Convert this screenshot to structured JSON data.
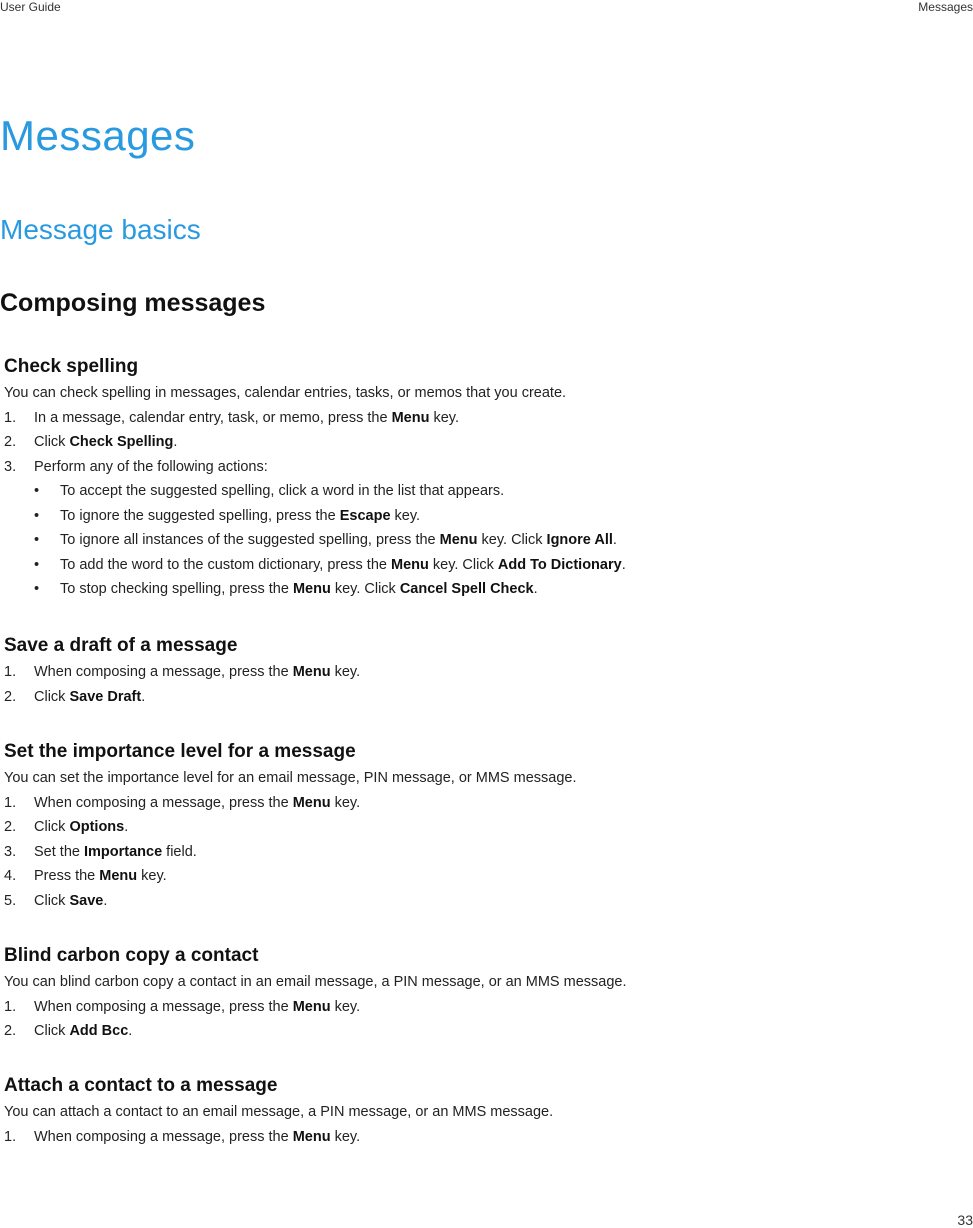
{
  "header": {
    "left": "User Guide",
    "right": "Messages"
  },
  "page_number": "33",
  "titles": {
    "chapter": "Messages",
    "section": "Message basics",
    "subsection": "Composing messages"
  },
  "topics": [
    {
      "title": "Check spelling",
      "intro": "You can check spelling in messages, calendar entries, tasks, or memos that you create.",
      "steps": [
        {
          "n": "1.",
          "pre": "In a message, calendar entry, task, or memo, press the ",
          "bold": "Menu",
          "post": " key."
        },
        {
          "n": "2.",
          "pre": "Click ",
          "bold": "Check Spelling",
          "post": "."
        },
        {
          "n": "3.",
          "pre": "Perform any of the following actions:",
          "bold": "",
          "post": ""
        }
      ],
      "bullets": [
        {
          "pre": "To accept the suggested spelling, click a word in the list that appears.",
          "b1": "",
          "mid": "",
          "b2": "",
          "post": ""
        },
        {
          "pre": "To ignore the suggested spelling, press the ",
          "b1": "Escape",
          "mid": " key.",
          "b2": "",
          "post": ""
        },
        {
          "pre": "To ignore all instances of the suggested spelling, press the ",
          "b1": "Menu",
          "mid": " key. Click ",
          "b2": "Ignore All",
          "post": "."
        },
        {
          "pre": "To add the word to the custom dictionary, press the ",
          "b1": "Menu",
          "mid": " key. Click ",
          "b2": "Add To Dictionary",
          "post": "."
        },
        {
          "pre": "To stop checking spelling, press the ",
          "b1": "Menu",
          "mid": " key. Click ",
          "b2": "Cancel Spell Check",
          "post": "."
        }
      ]
    },
    {
      "title": "Save a draft of a message",
      "steps": [
        {
          "n": "1.",
          "pre": "When composing a message, press the ",
          "bold": "Menu",
          "post": " key."
        },
        {
          "n": "2.",
          "pre": "Click ",
          "bold": "Save Draft",
          "post": "."
        }
      ]
    },
    {
      "title": "Set the importance level for a message",
      "intro": "You can set the importance level for an email message, PIN message, or MMS message.",
      "steps": [
        {
          "n": "1.",
          "pre": "When composing a message, press the ",
          "bold": "Menu",
          "post": " key."
        },
        {
          "n": "2.",
          "pre": "Click ",
          "bold": "Options",
          "post": "."
        },
        {
          "n": "3.",
          "pre": "Set the ",
          "bold": "Importance",
          "post": " field."
        },
        {
          "n": "4.",
          "pre": "Press the ",
          "bold": "Menu",
          "post": " key."
        },
        {
          "n": "5.",
          "pre": "Click ",
          "bold": "Save",
          "post": "."
        }
      ]
    },
    {
      "title": "Blind carbon copy a contact",
      "intro": "You can blind carbon copy a contact in an email message, a PIN message, or an MMS message.",
      "steps": [
        {
          "n": "1.",
          "pre": "When composing a message, press the ",
          "bold": "Menu",
          "post": " key."
        },
        {
          "n": "2.",
          "pre": "Click ",
          "bold": "Add Bcc",
          "post": "."
        }
      ]
    },
    {
      "title": "Attach a contact to a message",
      "intro": "You can attach a contact to an email message, a PIN message, or an MMS message.",
      "steps": [
        {
          "n": "1.",
          "pre": "When composing a message, press the ",
          "bold": "Menu",
          "post": " key."
        }
      ]
    }
  ]
}
